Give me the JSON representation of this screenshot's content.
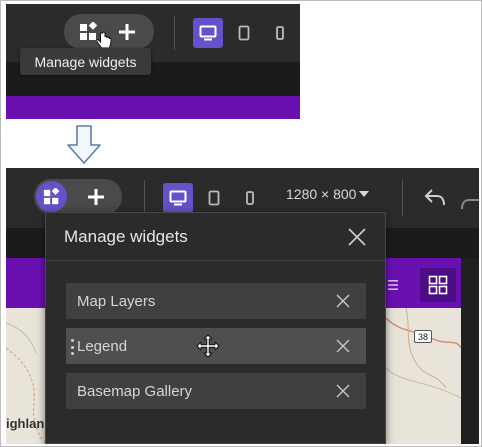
{
  "top_shot": {
    "tooltip": "Manage widgets"
  },
  "bottom_shot": {
    "zoom_level": "1280 × 800",
    "map_label": "ighlan",
    "road_number": "38",
    "modal": {
      "title": "Manage widgets",
      "widgets": [
        {
          "label": "Map Layers"
        },
        {
          "label": "Legend"
        },
        {
          "label": "Basemap Gallery"
        }
      ]
    }
  },
  "colors": {
    "accent": "#6651c9",
    "brand_bar": "#6a10b0",
    "toolbar_bg": "#2b2b2b"
  },
  "icons": {
    "manage_widgets": "widgets-icon",
    "add": "plus-icon",
    "desktop": "desktop-icon",
    "tablet": "tablet-icon",
    "phone": "phone-icon",
    "undo": "undo-icon",
    "redo": "redo-icon",
    "close": "close-icon",
    "drag": "drag-handle-icon",
    "move_cursor": "move-cursor-icon",
    "hand_cursor": "hand-cursor-icon",
    "transition_arrow": "down-arrow-icon"
  }
}
